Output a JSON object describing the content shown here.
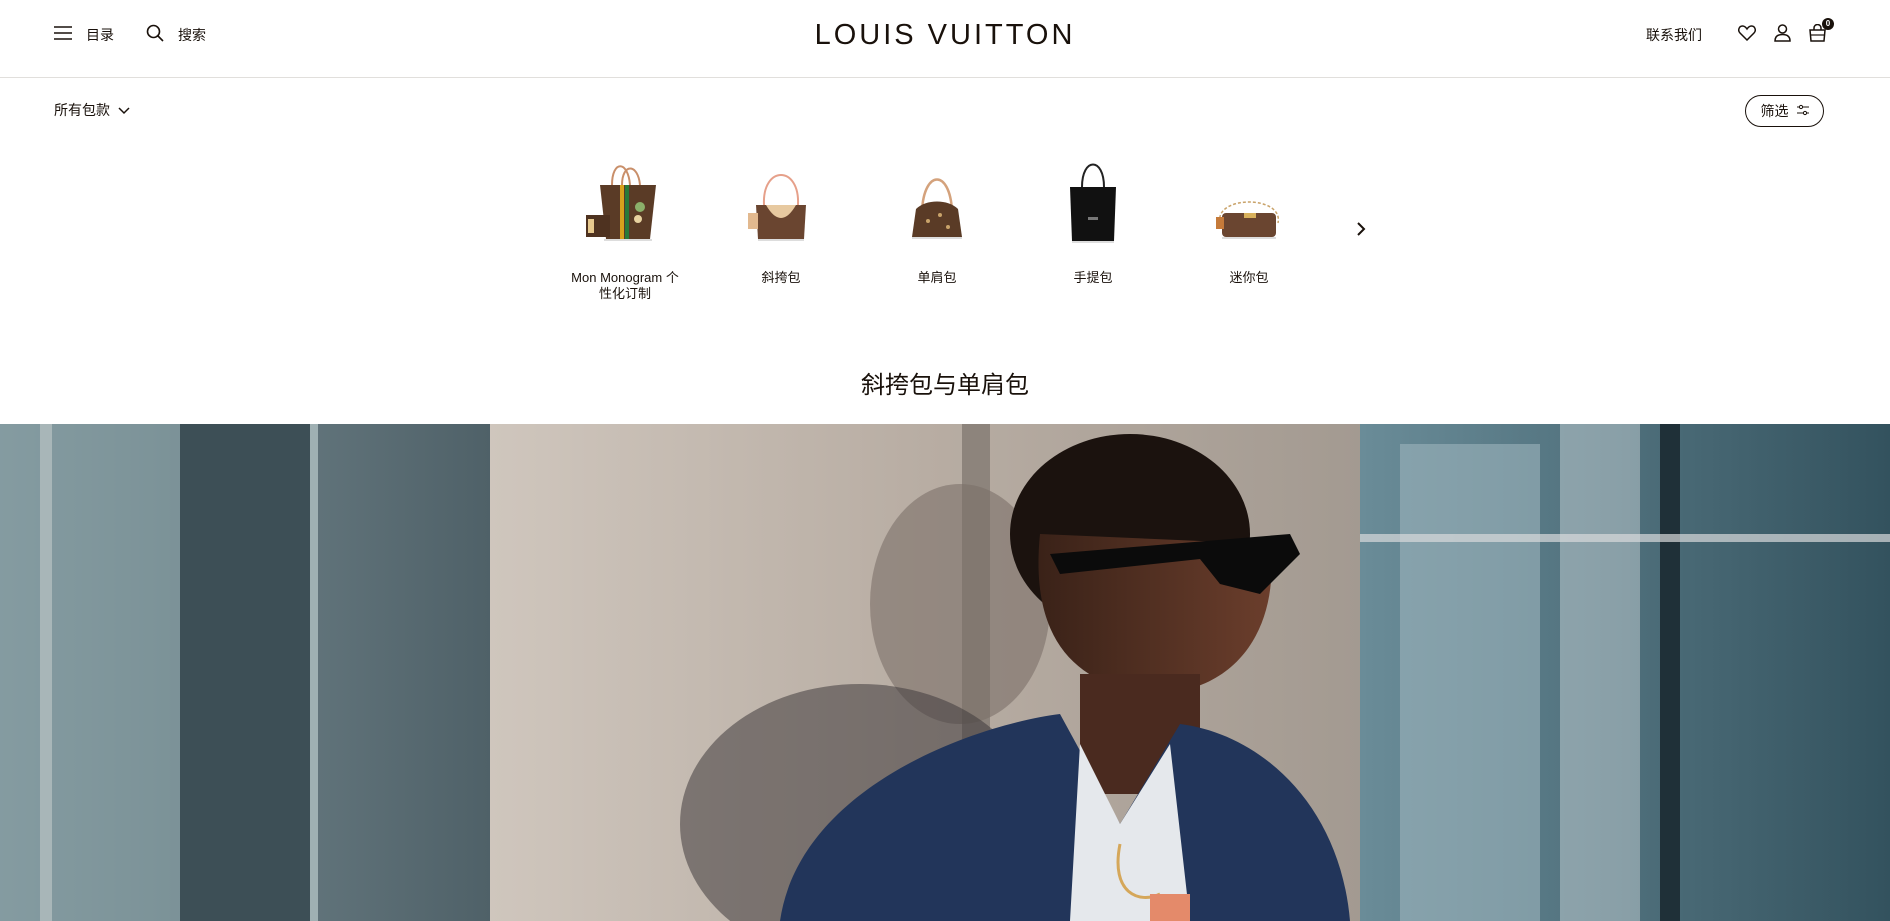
{
  "header": {
    "menu_label": "目录",
    "search_label": "搜索",
    "logo": "LOUIS VUITTON",
    "contact_label": "联系我们",
    "bag_count": "0"
  },
  "filter": {
    "category_label": "所有包款",
    "filter_button_label": "筛选"
  },
  "categories": [
    {
      "label": "Mon Monogram 个性化订制",
      "icon": "monogram-tote-icon"
    },
    {
      "label": "斜挎包",
      "icon": "crossbody-bag-icon"
    },
    {
      "label": "单肩包",
      "icon": "shoulder-bag-icon"
    },
    {
      "label": "手提包",
      "icon": "handbag-icon"
    },
    {
      "label": "迷你包",
      "icon": "mini-bag-icon"
    }
  ],
  "section": {
    "title": "斜挎包与单肩包"
  },
  "colors": {
    "text": "#19110b",
    "monogram_brown": "#5a3b26",
    "monogram_gold": "#c9a36a",
    "black_bag": "#111111"
  }
}
